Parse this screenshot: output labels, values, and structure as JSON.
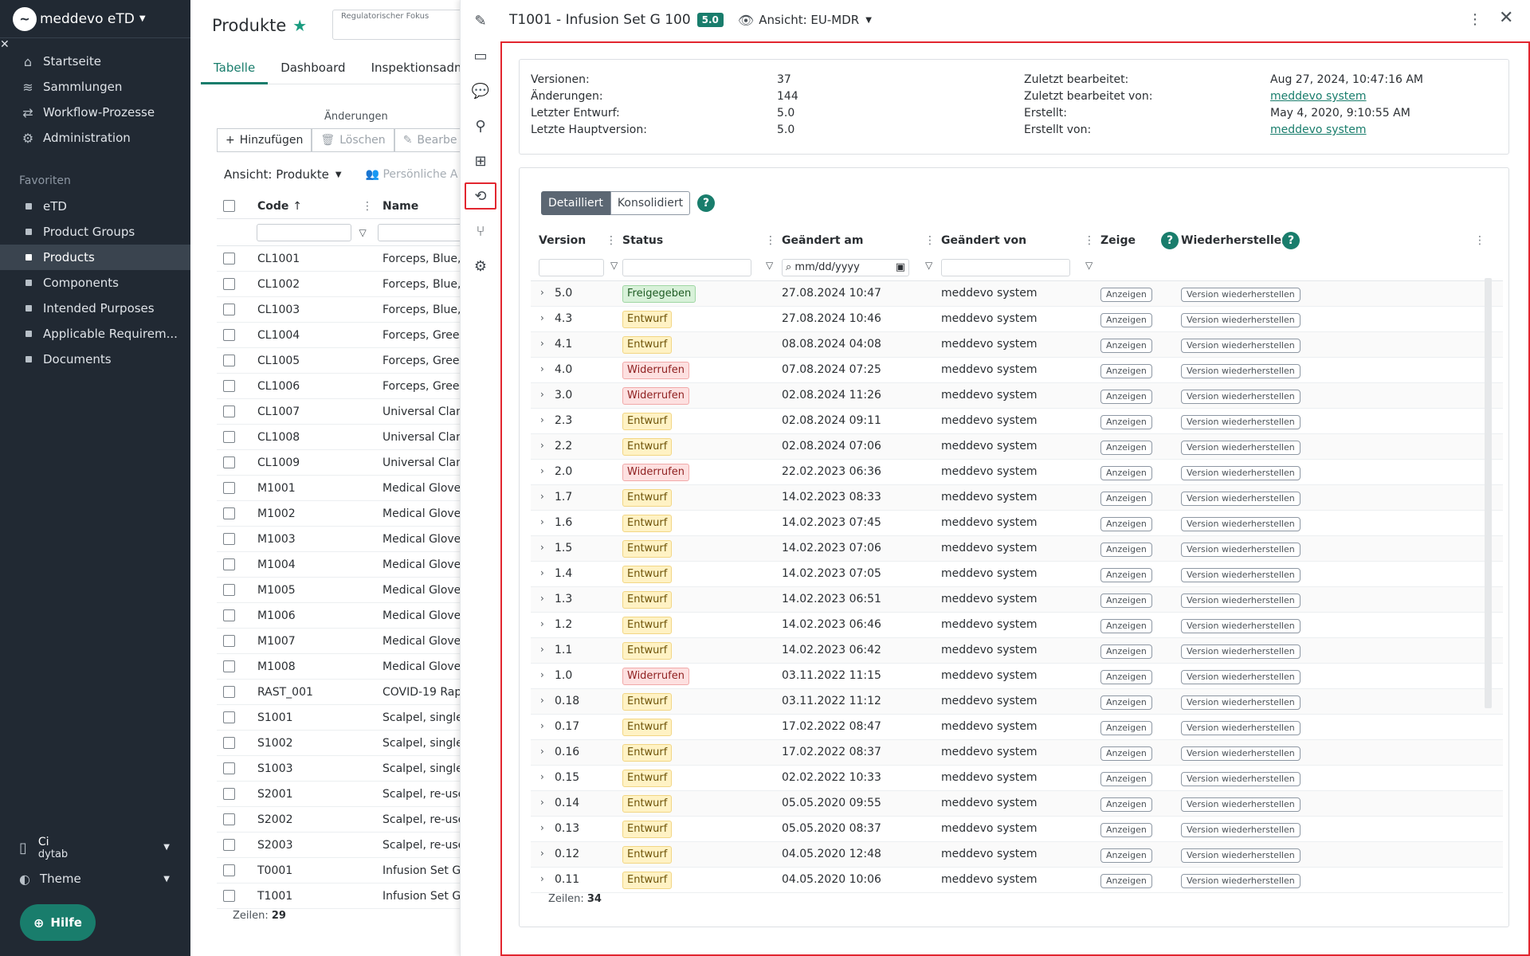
{
  "app": {
    "brand": "meddevo eTD",
    "close_icon": "close-icon"
  },
  "nav": [
    {
      "label": "Startseite",
      "icon": "home-icon"
    },
    {
      "label": "Sammlungen",
      "icon": "database-icon"
    },
    {
      "label": "Workflow-Prozesse",
      "icon": "workflow-icon"
    },
    {
      "label": "Administration",
      "icon": "user-gear-icon"
    }
  ],
  "favorites": {
    "title": "Favoriten",
    "items": [
      {
        "label": "eTD",
        "active": false
      },
      {
        "label": "Product Groups",
        "active": false
      },
      {
        "label": "Products",
        "active": true
      },
      {
        "label": "Components",
        "active": false
      },
      {
        "label": "Intended Purposes",
        "active": false
      },
      {
        "label": "Applicable Requirem...",
        "active": false
      },
      {
        "label": "Documents",
        "active": false
      }
    ]
  },
  "user": {
    "line1": "Ci",
    "line2": "dytab"
  },
  "theme": {
    "label": "Theme"
  },
  "help": {
    "label": "Hilfe"
  },
  "products": {
    "title": "Produkte",
    "regulatory_focus_placeholder": "Regulatorischer Fokus",
    "tabs": [
      "Tabelle",
      "Dashboard",
      "Inspektionsadmin"
    ],
    "changes_label": "Änderungen",
    "toolbar": {
      "add": "Hinzufügen",
      "delete": "Löschen",
      "edit": "Bearbe"
    },
    "view_label": "Ansicht: Produkte",
    "personal_label": "Persönliche A",
    "columns": {
      "code": "Code",
      "name": "Name"
    },
    "rows": [
      {
        "code": "CL1001",
        "name": "Forceps, Blue,"
      },
      {
        "code": "CL1002",
        "name": "Forceps, Blue,"
      },
      {
        "code": "CL1003",
        "name": "Forceps, Blue,"
      },
      {
        "code": "CL1004",
        "name": "Forceps, Greer"
      },
      {
        "code": "CL1005",
        "name": "Forceps, Greer"
      },
      {
        "code": "CL1006",
        "name": "Forceps, Greer"
      },
      {
        "code": "CL1007",
        "name": "Universal Clam"
      },
      {
        "code": "CL1008",
        "name": "Universal Clam"
      },
      {
        "code": "CL1009",
        "name": "Universal Clam"
      },
      {
        "code": "M1001",
        "name": "Medical Glove"
      },
      {
        "code": "M1002",
        "name": "Medical Glove"
      },
      {
        "code": "M1003",
        "name": "Medical Glove"
      },
      {
        "code": "M1004",
        "name": "Medical Glove"
      },
      {
        "code": "M1005",
        "name": "Medical Glove"
      },
      {
        "code": "M1006",
        "name": "Medical Glove"
      },
      {
        "code": "M1007",
        "name": "Medical Glove"
      },
      {
        "code": "M1008",
        "name": "Medical Glove"
      },
      {
        "code": "RAST_001",
        "name": "COVID-19 Rapi"
      },
      {
        "code": "S1001",
        "name": "Scalpel, single"
      },
      {
        "code": "S1002",
        "name": "Scalpel, single"
      },
      {
        "code": "S1003",
        "name": "Scalpel, single"
      },
      {
        "code": "S2001",
        "name": "Scalpel, re-use"
      },
      {
        "code": "S2002",
        "name": "Scalpel, re-use"
      },
      {
        "code": "S2003",
        "name": "Scalpel, re-use"
      },
      {
        "code": "T0001",
        "name": "Infusion Set G"
      },
      {
        "code": "T1001",
        "name": "Infusion Set G"
      }
    ],
    "rows_label": "Zeilen:",
    "rows_count": "29"
  },
  "strip": [
    "edit-icon",
    "card-icon",
    "comment-icon",
    "tree-icon",
    "structure-icon",
    "history-icon",
    "branch-icon",
    "settings-flow-icon"
  ],
  "panel": {
    "title": "T1001 - Infusion Set G 100",
    "version_badge": "5.0",
    "view_label": "Ansicht: EU-MDR",
    "info_left": [
      {
        "label": "Versionen:",
        "value": "37"
      },
      {
        "label": "Änderungen:",
        "value": "144"
      },
      {
        "label": "Letzter Entwurf:",
        "value": "5.0"
      },
      {
        "label": "Letzte Hauptversion:",
        "value": "5.0"
      }
    ],
    "info_right": [
      {
        "label": "Zuletzt bearbeitet:",
        "value": "Aug 27, 2024, 10:47:16 AM",
        "link": false
      },
      {
        "label": "Zuletzt bearbeitet von:",
        "value": "meddevo system",
        "link": true
      },
      {
        "label": "Erstellt:",
        "value": "May 4, 2020, 9:10:55 AM",
        "link": false
      },
      {
        "label": "Erstellt von:",
        "value": "meddevo system",
        "link": true
      }
    ],
    "segments": [
      "Detailliert",
      "Konsolidiert"
    ],
    "columns": {
      "version": "Version",
      "status": "Status",
      "changed_at": "Geändert am",
      "changed_by": "Geändert von",
      "show": "Zeige",
      "restore": "Wiederherstellen"
    },
    "date_placeholder": "mm/dd/yyyy",
    "show_button": "Anzeigen",
    "restore_button": "Version wiederherstellen",
    "status_colors": {
      "Freigegeben": "#d8f1d9",
      "Entwurf": "#fff2c4",
      "Widerrufen": "#fde0e0"
    },
    "history": [
      {
        "version": "5.0",
        "status": "Freigegeben",
        "date": "27.08.2024 10:47",
        "by": "meddevo system"
      },
      {
        "version": "4.3",
        "status": "Entwurf",
        "date": "27.08.2024 10:46",
        "by": "meddevo system"
      },
      {
        "version": "4.1",
        "status": "Entwurf",
        "date": "08.08.2024 04:08",
        "by": "meddevo system"
      },
      {
        "version": "4.0",
        "status": "Widerrufen",
        "date": "07.08.2024 07:25",
        "by": "meddevo system"
      },
      {
        "version": "3.0",
        "status": "Widerrufen",
        "date": "02.08.2024 11:26",
        "by": "meddevo system"
      },
      {
        "version": "2.3",
        "status": "Entwurf",
        "date": "02.08.2024 09:11",
        "by": "meddevo system"
      },
      {
        "version": "2.2",
        "status": "Entwurf",
        "date": "02.08.2024 07:06",
        "by": "meddevo system"
      },
      {
        "version": "2.0",
        "status": "Widerrufen",
        "date": "22.02.2023 06:36",
        "by": "meddevo system"
      },
      {
        "version": "1.7",
        "status": "Entwurf",
        "date": "14.02.2023 08:33",
        "by": "meddevo system"
      },
      {
        "version": "1.6",
        "status": "Entwurf",
        "date": "14.02.2023 07:45",
        "by": "meddevo system"
      },
      {
        "version": "1.5",
        "status": "Entwurf",
        "date": "14.02.2023 07:06",
        "by": "meddevo system"
      },
      {
        "version": "1.4",
        "status": "Entwurf",
        "date": "14.02.2023 07:05",
        "by": "meddevo system"
      },
      {
        "version": "1.3",
        "status": "Entwurf",
        "date": "14.02.2023 06:51",
        "by": "meddevo system"
      },
      {
        "version": "1.2",
        "status": "Entwurf",
        "date": "14.02.2023 06:46",
        "by": "meddevo system"
      },
      {
        "version": "1.1",
        "status": "Entwurf",
        "date": "14.02.2023 06:42",
        "by": "meddevo system"
      },
      {
        "version": "1.0",
        "status": "Widerrufen",
        "date": "03.11.2022 11:15",
        "by": "meddevo system"
      },
      {
        "version": "0.18",
        "status": "Entwurf",
        "date": "03.11.2022 11:12",
        "by": "meddevo system"
      },
      {
        "version": "0.17",
        "status": "Entwurf",
        "date": "17.02.2022 08:47",
        "by": "meddevo system"
      },
      {
        "version": "0.16",
        "status": "Entwurf",
        "date": "17.02.2022 08:37",
        "by": "meddevo system"
      },
      {
        "version": "0.15",
        "status": "Entwurf",
        "date": "02.02.2022 10:33",
        "by": "meddevo system"
      },
      {
        "version": "0.14",
        "status": "Entwurf",
        "date": "05.05.2020 09:55",
        "by": "meddevo system"
      },
      {
        "version": "0.13",
        "status": "Entwurf",
        "date": "05.05.2020 08:37",
        "by": "meddevo system"
      },
      {
        "version": "0.12",
        "status": "Entwurf",
        "date": "04.05.2020 12:48",
        "by": "meddevo system"
      },
      {
        "version": "0.11",
        "status": "Entwurf",
        "date": "04.05.2020 10:06",
        "by": "meddevo system"
      }
    ],
    "rows_label": "Zeilen:",
    "rows_count": "34"
  }
}
